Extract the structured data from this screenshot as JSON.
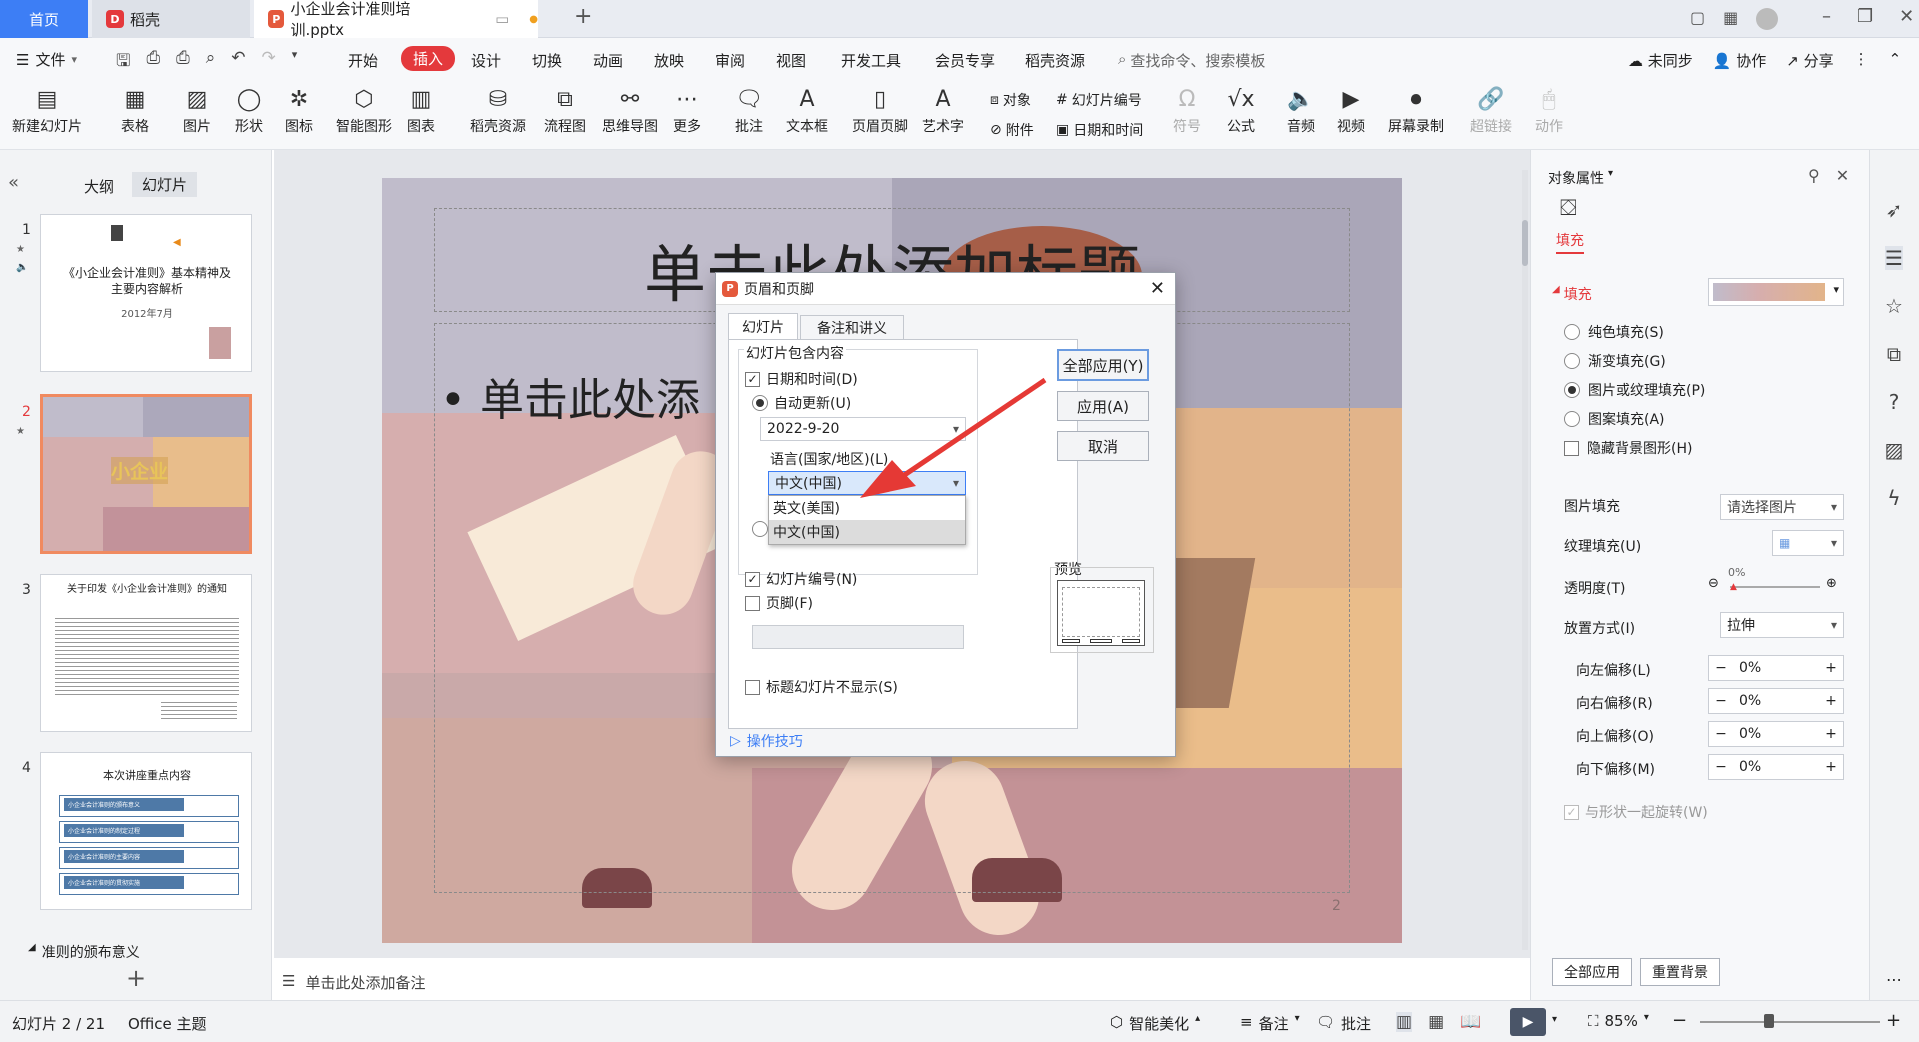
{
  "tabs": {
    "home": "首页",
    "daoke": "稻壳",
    "file": "小企业会计准则培训.pptx"
  },
  "menu": {
    "file": "文件",
    "items": [
      "开始",
      "插入",
      "设计",
      "切换",
      "动画",
      "放映",
      "审阅",
      "视图",
      "开发工具",
      "会员专享",
      "稻壳资源"
    ],
    "search": "查找命令、搜索模板",
    "sync": "未同步",
    "collab": "协作",
    "share": "分享"
  },
  "ribbon": {
    "new_slide": "新建幻灯片",
    "table": "表格",
    "image": "图片",
    "shape": "形状",
    "icon": "图标",
    "smart": "智能图形",
    "chart": "图表",
    "daoke_res": "稻壳资源",
    "flow": "流程图",
    "mind": "思维导图",
    "more": "更多",
    "comment": "批注",
    "textbox": "文本框",
    "header_footer": "页眉页脚",
    "art": "艺术字",
    "object": "对象",
    "slide_number": "幻灯片编号",
    "attach": "附件",
    "datetime": "日期和时间",
    "symbol": "符号",
    "formula": "公式",
    "audio": "音频",
    "video": "视频",
    "screen_rec": "屏幕录制",
    "hyperlink": "超链接",
    "action": "动作"
  },
  "left": {
    "tab_outline": "大纲",
    "tab_slides": "幻灯片",
    "section": "准则的颁布意义",
    "t1_title": "《小企业会计准则》基本精神及主要内容解析",
    "t1_date": "2012年7月",
    "t2_text": "小企业",
    "t3_title": "关于印发《小企业会计准则》的通知",
    "t4_title": "本次讲座重点内容",
    "t4_items": [
      "小企业会计准则的颁布意义",
      "小企业会计准则的制定过程",
      "小企业会计准则的主要内容",
      "小企业会计准则的贯彻实施"
    ],
    "nums": [
      "1",
      "2",
      "3",
      "4"
    ]
  },
  "slide": {
    "title": "单击此处添加标题",
    "body": "单击此处添",
    "page": "2",
    "notes": "单击此处添加备注"
  },
  "dialog": {
    "title": "页眉和页脚",
    "tab1": "幻灯片",
    "tab2": "备注和讲义",
    "group": "幻灯片包含内容",
    "datetime": "日期和时间(D)",
    "auto": "自动更新(U)",
    "date_value": "2022-9-20",
    "lang_label": "语言(国家/地区)(L)",
    "lang_value": "中文(中国)",
    "opt1": "英文(美国)",
    "opt2": "中文(中国)",
    "slide_num": "幻灯片编号(N)",
    "footer": "页脚(F)",
    "hide_title": "标题幻灯片不显示(S)",
    "apply_all": "全部应用(Y)",
    "apply": "应用(A)",
    "cancel": "取消",
    "preview": "预览",
    "tips": "操作技巧"
  },
  "right": {
    "title": "对象属性",
    "fill_tab": "填充",
    "fill_section": "填充",
    "r1": "纯色填充(S)",
    "r2": "渐变填充(G)",
    "r3": "图片或纹理填充(P)",
    "r4": "图案填充(A)",
    "hide_bg": "隐藏背景图形(H)",
    "pic_fill": "图片填充",
    "pic_fill_value": "请选择图片",
    "texture": "纹理填充(U)",
    "transparency": "透明度(T)",
    "trans_value": "0%",
    "placement": "放置方式(I)",
    "placement_value": "拉伸",
    "off_left": "向左偏移(L)",
    "off_right": "向右偏移(R)",
    "off_up": "向上偏移(O)",
    "off_down": "向下偏移(M)",
    "off_value": "0%",
    "rotate": "与形状一起旋转(W)",
    "apply_all": "全部应用",
    "reset": "重置背景"
  },
  "status": {
    "slide": "幻灯片 2 / 21",
    "theme": "Office 主题",
    "beautify": "智能美化",
    "notes": "备注",
    "comment": "批注",
    "zoom": "85%"
  },
  "colors": {
    "accent": "#3d7ef5",
    "active_tab": "#e4393c",
    "arrow": "#e53935"
  }
}
